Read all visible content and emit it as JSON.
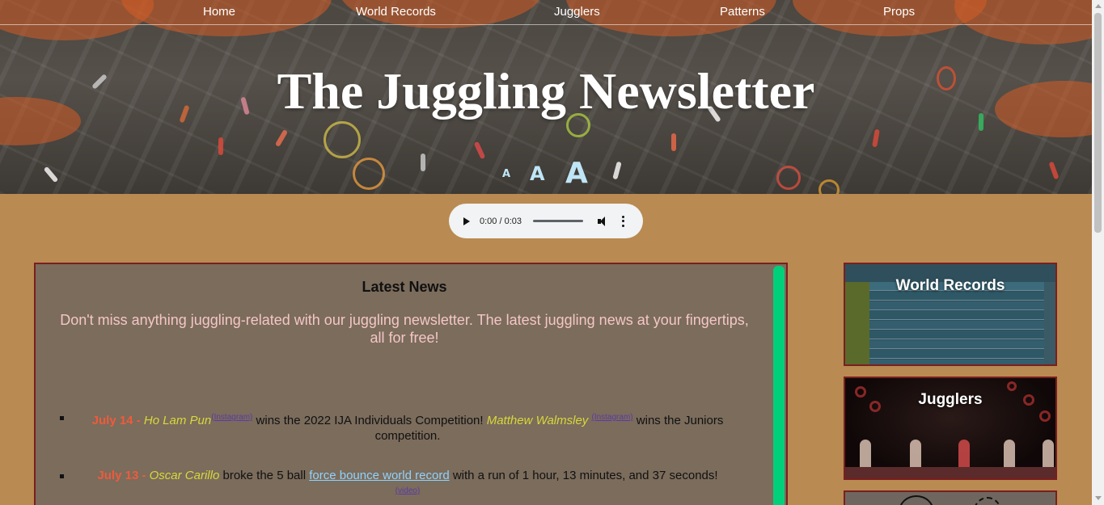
{
  "nav": {
    "items": [
      {
        "label": "Home"
      },
      {
        "label": "World Records"
      },
      {
        "label": "Jugglers"
      },
      {
        "label": "Patterns"
      },
      {
        "label": "Props"
      }
    ]
  },
  "header": {
    "title": "The Juggling Newsletter",
    "font_size_buttons": [
      "A",
      "A",
      "A"
    ]
  },
  "audio": {
    "time": "0:00 / 0:03"
  },
  "news": {
    "title": "Latest News",
    "intro": "Don't miss anything juggling-related with our juggling newsletter. The latest juggling news at your fingertips, all for free!",
    "items": [
      {
        "date": "July 14 -",
        "person1": "Ho Lam Pun",
        "link1": "(Instagram)",
        "text1": "wins the 2022 IJA Individuals Competition!",
        "person2": "Matthew Walmsley",
        "link2": "(Instagram)",
        "text2": "wins the Juniors competition."
      },
      {
        "date": "July 13 -",
        "person1": "Oscar Carillo",
        "text1": "broke the 5 ball",
        "link_big": "force bounce world record",
        "text2": "with a run of 1 hour, 13 minutes, and 37 seconds!",
        "link2": "(video)"
      }
    ]
  },
  "sidebar": {
    "cards": [
      {
        "label": "World Records"
      },
      {
        "label": "Jugglers"
      }
    ]
  },
  "colors": {
    "background": "#b98a51",
    "accent_green": "#00d07a",
    "date_red": "#f05a3c",
    "name_yellow": "#d8d83a"
  }
}
